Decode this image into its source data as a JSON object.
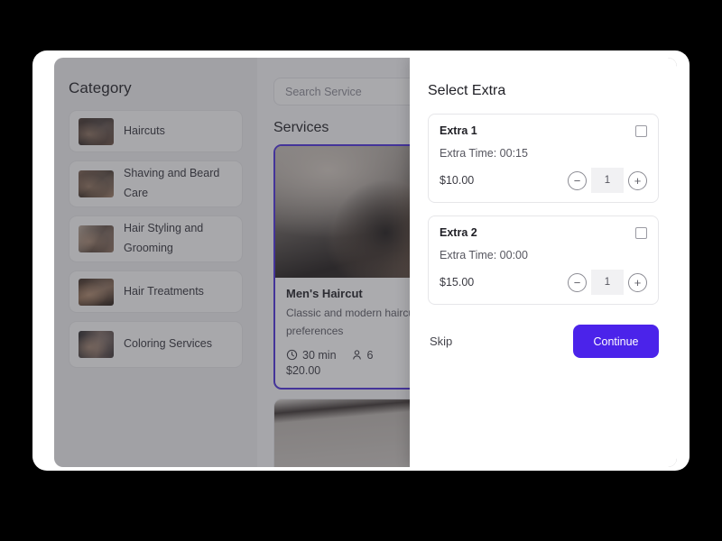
{
  "colors": {
    "accent": "#4b23ea",
    "selected_card_border": "#4b30d8",
    "panel_bg": "#ffffff",
    "sidebar_bg": "#ebebec",
    "main_bg": "#f3f3f4",
    "overlay": "rgba(60,60,66,0.42)"
  },
  "sidebar": {
    "title": "Category",
    "items": [
      {
        "label": "Haircuts",
        "thumb": "haircuts-thumbnail"
      },
      {
        "label": "Shaving and Beard Care",
        "thumb": "shaving-thumbnail"
      },
      {
        "label": "Hair Styling and Grooming",
        "thumb": "styling-thumbnail"
      },
      {
        "label": "Hair Treatments",
        "thumb": "treatments-thumbnail"
      },
      {
        "label": "Coloring Services",
        "thumb": "coloring-thumbnail"
      }
    ]
  },
  "main": {
    "search": {
      "placeholder": "Search Service",
      "value": "",
      "icon": "search-icon"
    },
    "services_title": "Services",
    "services": [
      {
        "name": "Men's Haircut",
        "description": "Classic and modern haircuts tailored to your preferences",
        "duration": "30 min",
        "duration_icon": "clock-icon",
        "capacity": "6",
        "capacity_icon": "person-icon",
        "price": "$20.00",
        "selected": true
      }
    ]
  },
  "modal": {
    "title": "Select Extra",
    "extras": [
      {
        "name": "Extra 1",
        "time_label": "Extra Time: 00:15",
        "price": "$10.00",
        "quantity": "1",
        "checked": false,
        "decrement_label": "−",
        "increment_label": "+"
      },
      {
        "name": "Extra 2",
        "time_label": "Extra Time: 00:00",
        "price": "$15.00",
        "quantity": "1",
        "checked": false,
        "decrement_label": "−",
        "increment_label": "+"
      }
    ],
    "skip_label": "Skip",
    "continue_label": "Continue"
  }
}
